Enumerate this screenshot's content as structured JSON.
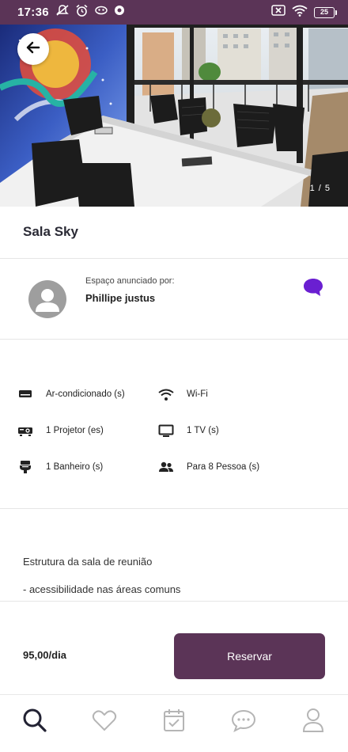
{
  "status_bar": {
    "time": "17:36",
    "battery_level": "25",
    "icons": [
      "muted-notifications-icon",
      "alarm-icon",
      "ghost-app-icon",
      "app-icon",
      "sim-off-icon",
      "wifi-icon",
      "battery-icon"
    ]
  },
  "hero": {
    "image_counter": "1 / 5",
    "back_icon": "arrow-left-icon"
  },
  "space": {
    "title": "Sala Sky"
  },
  "host": {
    "caption": "Espaço anunciado por:",
    "name": "Phillipe justus",
    "chat_icon": "chat-bubble-icon"
  },
  "amenities": [
    {
      "label": "Ar-condicionado (s)",
      "icon": "air-conditioner-icon"
    },
    {
      "label": "Wi-Fi",
      "icon": "wifi-icon"
    },
    {
      "label": "1 Projetor (es)",
      "icon": "projector-icon"
    },
    {
      "label": "1 TV (s)",
      "icon": "tv-icon"
    },
    {
      "label": "1 Banheiro (s)",
      "icon": "toilet-icon"
    },
    {
      "label": "Para 8 Pessoa (s)",
      "icon": "people-icon"
    }
  ],
  "description": {
    "heading": "Estrutura da sala de reunião",
    "lines": [
      "- acessibilidade nas áreas comuns"
    ]
  },
  "booking": {
    "price": "95,00/dia",
    "reserve_label": "Reservar"
  },
  "bottom_nav": [
    {
      "name": "search",
      "icon": "search-icon",
      "active": true
    },
    {
      "name": "favorites",
      "icon": "heart-icon",
      "active": false
    },
    {
      "name": "reservations",
      "icon": "calendar-check-icon",
      "active": false
    },
    {
      "name": "messages",
      "icon": "chat-icon",
      "active": false
    },
    {
      "name": "profile",
      "icon": "user-icon",
      "active": false
    }
  ],
  "colors": {
    "brand": "#5b3457",
    "chat_accent": "#6a1fd1",
    "inactive_nav": "#b5b5b5",
    "active_nav": "#222233"
  }
}
